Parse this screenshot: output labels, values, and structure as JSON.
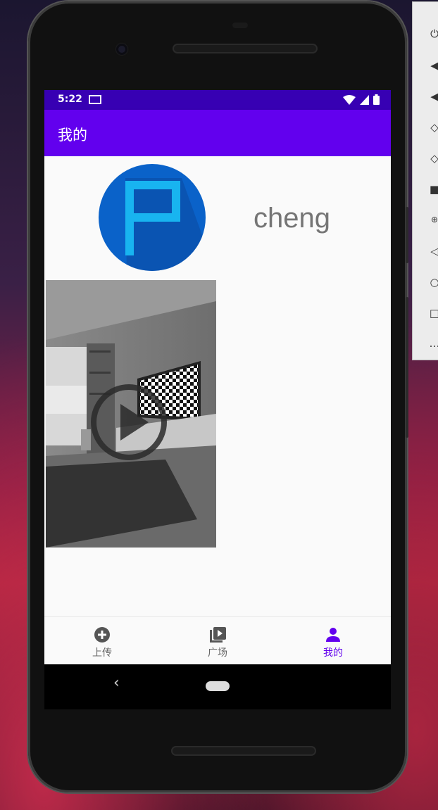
{
  "status_bar": {
    "time": "5:22"
  },
  "app_bar": {
    "title": "我的"
  },
  "profile": {
    "username": "cheng"
  },
  "bottom_nav": {
    "items": [
      {
        "label": "上传",
        "icon": "add-circle-icon",
        "active": false
      },
      {
        "label": "广场",
        "icon": "video-library-icon",
        "active": false
      },
      {
        "label": "我的",
        "icon": "person-icon",
        "active": true
      }
    ]
  },
  "colors": {
    "status_bar": "#3700b3",
    "app_bar": "#6200ee",
    "active_tab": "#6200ee",
    "avatar_bg": "#0a62c9"
  },
  "emulator_panel": {
    "icons": [
      "power-icon",
      "volume-up-icon",
      "volume-down-icon",
      "rotate-left-icon",
      "rotate-right-icon",
      "camera-icon",
      "zoom-icon",
      "back-icon",
      "home-icon",
      "overview-icon",
      "more-icon"
    ]
  }
}
